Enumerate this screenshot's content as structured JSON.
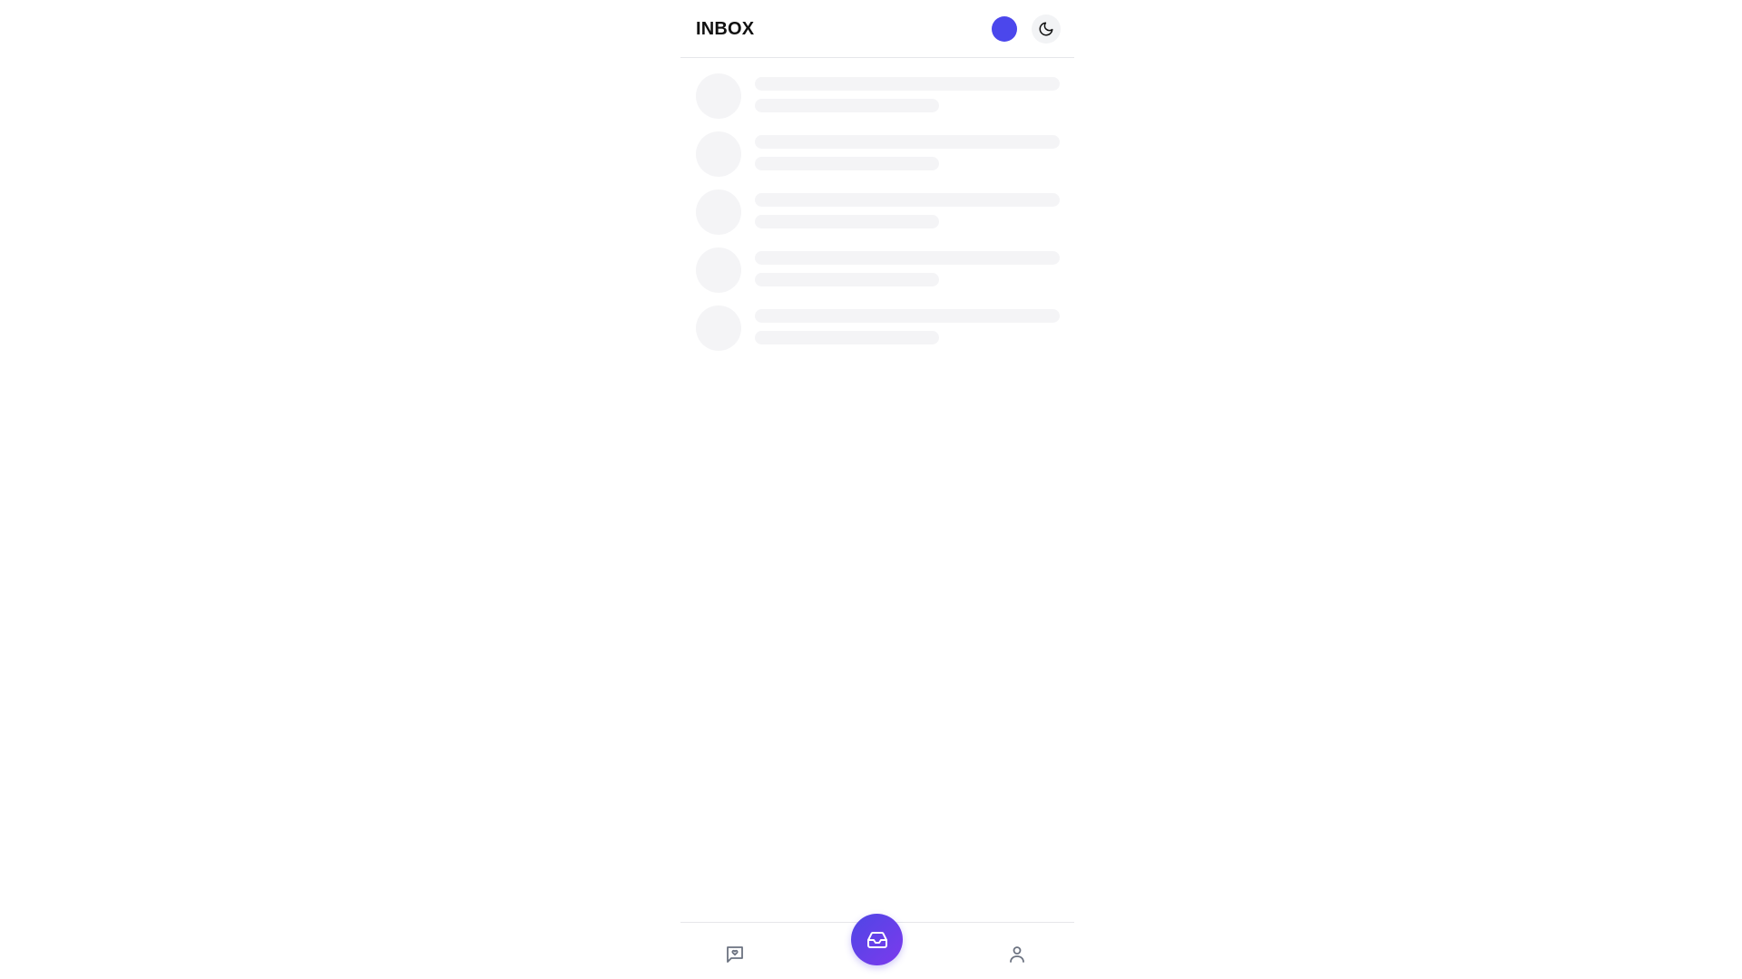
{
  "header": {
    "title": "INBOX",
    "avatar_color": "#4b47ec",
    "theme_toggle_icon": "moon-icon"
  },
  "skeleton_list": {
    "row_count": 5,
    "placeholder_color": "#f4f4f6"
  },
  "bottom_nav": {
    "items": [
      {
        "icon": "message-heart-icon",
        "active": false
      },
      {
        "icon": "inbox-tray-icon",
        "active": true
      },
      {
        "icon": "user-icon",
        "active": false
      }
    ],
    "active_gradient": [
      "#4f46e5",
      "#7c3aed"
    ],
    "inactive_icon_color": "#6b7280"
  }
}
